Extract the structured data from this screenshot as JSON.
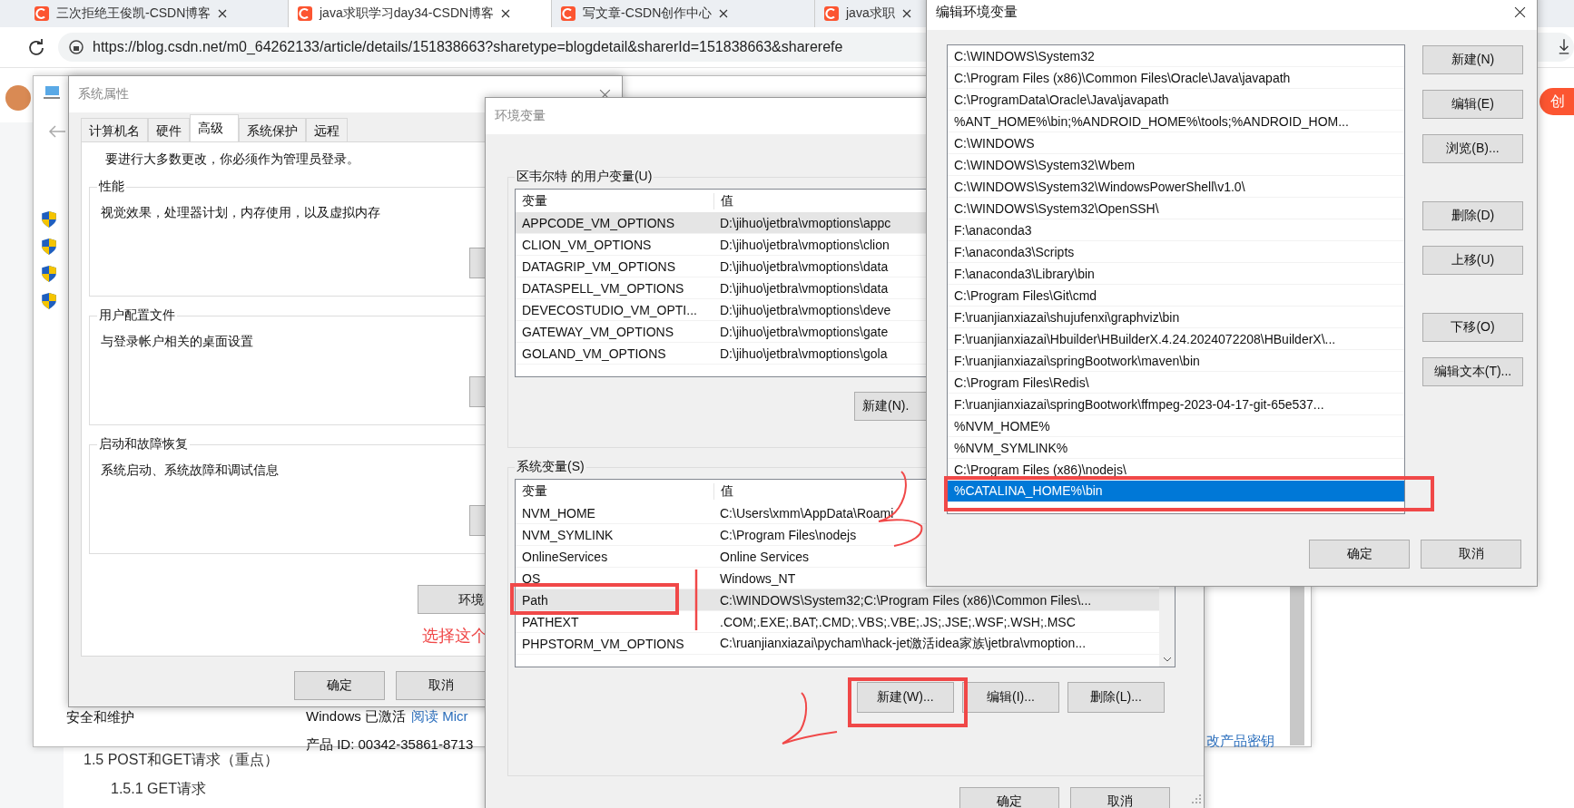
{
  "browser": {
    "tabs": [
      {
        "title": "三次拒绝王俊凯-CSDN博客",
        "selected": false
      },
      {
        "title": "java求职学习day34-CSDN博客",
        "selected": true
      },
      {
        "title": "写文章-CSDN创作中心",
        "selected": false
      },
      {
        "title": "java求职",
        "selected": false
      }
    ],
    "url": "https://blog.csdn.net/m0_64262133/article/details/151838663?sharetype=blogdetail&sharerId=151838663&sharerefe",
    "create_button": "创"
  },
  "page": {
    "headings": [
      "1.5 POST和GET请求（重点）",
      "1.5.1 GET请求"
    ]
  },
  "control_panel": {
    "item": "安全和维护",
    "activation": "Windows 已激活",
    "activation_link": "阅读 Micr",
    "product_id": "产品 ID: 00342-35861-8713",
    "change_key_link": "改产品密钥"
  },
  "system_properties": {
    "title": "系统属性",
    "tabs": [
      {
        "label": "计算机名",
        "selected": false
      },
      {
        "label": "硬件",
        "selected": false
      },
      {
        "label": "高级",
        "selected": true
      },
      {
        "label": "系统保护",
        "selected": false
      },
      {
        "label": "远程",
        "selected": false
      }
    ],
    "notice": "要进行大多数更改，你必须作为管理员登录。",
    "groups": [
      {
        "title": "性能",
        "description": "视觉效果，处理器计划，内存使用，以及虚拟内存"
      },
      {
        "title": "用户配置文件",
        "description": "与登录帐户相关的桌面设置"
      },
      {
        "title": "启动和故障恢复",
        "description": "系统启动、系统故障和调试信息"
      }
    ],
    "env_button": "环境",
    "buttons": [
      "确定",
      "取消"
    ]
  },
  "environment_variables": {
    "title": "环境变量",
    "user": {
      "title": "区韦尔特 的用户变量(U)",
      "columns": [
        "变量",
        "值"
      ],
      "rows": [
        {
          "name": "APPCODE_VM_OPTIONS",
          "value": "D:\\jihuo\\jetbra\\vmoptions\\appc",
          "selected": true
        },
        {
          "name": "CLION_VM_OPTIONS",
          "value": "D:\\jihuo\\jetbra\\vmoptions\\clion",
          "selected": false
        },
        {
          "name": "DATAGRIP_VM_OPTIONS",
          "value": "D:\\jihuo\\jetbra\\vmoptions\\data",
          "selected": false
        },
        {
          "name": "DATASPELL_VM_OPTIONS",
          "value": "D:\\jihuo\\jetbra\\vmoptions\\data",
          "selected": false
        },
        {
          "name": "DEVECOSTUDIO_VM_OPTI...",
          "value": "D:\\jihuo\\jetbra\\vmoptions\\deve",
          "selected": false
        },
        {
          "name": "GATEWAY_VM_OPTIONS",
          "value": "D:\\jihuo\\jetbra\\vmoptions\\gate",
          "selected": false
        },
        {
          "name": "GOLAND_VM_OPTIONS",
          "value": "D:\\jihuo\\jetbra\\vmoptions\\gola",
          "selected": false
        }
      ],
      "buttons": [
        "新建(N)."
      ]
    },
    "system": {
      "title": "系统变量(S)",
      "columns": [
        "变量",
        "值"
      ],
      "rows": [
        {
          "name": "NVM_HOME",
          "value": "C:\\Users\\xmm\\AppData\\Roami",
          "selected": false
        },
        {
          "name": "NVM_SYMLINK",
          "value": "C:\\Program Files\\nodejs",
          "selected": false
        },
        {
          "name": "OnlineServices",
          "value": "Online Services",
          "selected": false
        },
        {
          "name": "OS",
          "value": "Windows_NT",
          "selected": false
        },
        {
          "name": "Path",
          "value": "C:\\WINDOWS\\System32;C:\\Program Files (x86)\\Common Files\\...",
          "selected": true
        },
        {
          "name": "PATHEXT",
          "value": ".COM;.EXE;.BAT;.CMD;.VBS;.VBE;.JS;.JSE;.WSF;.WSH;.MSC",
          "selected": false
        },
        {
          "name": "PHPSTORM_VM_OPTIONS",
          "value": "C:\\ruanjianxiazai\\pycham\\hack-jet激活idea家族\\jetbra\\vmoption...",
          "selected": false
        }
      ],
      "buttons": [
        "新建(W)...",
        "编辑(I)...",
        "删除(L)..."
      ]
    },
    "buttons": [
      "确定",
      "取消"
    ]
  },
  "edit_dialog": {
    "title": "编辑环境变量",
    "entries": [
      {
        "text": "C:\\WINDOWS\\System32",
        "selected": false
      },
      {
        "text": "C:\\Program Files (x86)\\Common Files\\Oracle\\Java\\javapath",
        "selected": false
      },
      {
        "text": "C:\\ProgramData\\Oracle\\Java\\javapath",
        "selected": false
      },
      {
        "text": "%ANT_HOME%\\bin;%ANDROID_HOME%\\tools;%ANDROID_HOM...",
        "selected": false
      },
      {
        "text": "C:\\WINDOWS",
        "selected": false
      },
      {
        "text": "C:\\WINDOWS\\System32\\Wbem",
        "selected": false
      },
      {
        "text": "C:\\WINDOWS\\System32\\WindowsPowerShell\\v1.0\\",
        "selected": false
      },
      {
        "text": "C:\\WINDOWS\\System32\\OpenSSH\\",
        "selected": false
      },
      {
        "text": "F:\\anaconda3",
        "selected": false
      },
      {
        "text": "F:\\anaconda3\\Scripts",
        "selected": false
      },
      {
        "text": "F:\\anaconda3\\Library\\bin",
        "selected": false
      },
      {
        "text": "C:\\Program Files\\Git\\cmd",
        "selected": false
      },
      {
        "text": "F:\\ruanjianxiazai\\shujufenxi\\graphviz\\bin",
        "selected": false
      },
      {
        "text": "F:\\ruanjianxiazai\\Hbuilder\\HBuilderX.4.24.2024072208\\HBuilderX\\...",
        "selected": false
      },
      {
        "text": "F:\\ruanjianxiazai\\springBootwork\\maven\\bin",
        "selected": false
      },
      {
        "text": "C:\\Program Files\\Redis\\",
        "selected": false
      },
      {
        "text": "F:\\ruanjianxiazai\\springBootwork\\ffmpeg-2023-04-17-git-65e537...",
        "selected": false
      },
      {
        "text": "%NVM_HOME%",
        "selected": false
      },
      {
        "text": "%NVM_SYMLINK%",
        "selected": false
      },
      {
        "text": "C:\\Program Files (x86)\\nodejs\\",
        "selected": false
      },
      {
        "text": "%CATALINA_HOME%\\bin",
        "selected": true
      }
    ],
    "side_buttons": [
      "新建(N)",
      "编辑(E)",
      "浏览(B)...",
      "删除(D)",
      "上移(U)",
      "下移(O)",
      "编辑文本(T)..."
    ],
    "buttons": [
      "确定",
      "取消"
    ]
  },
  "annotations": {
    "note": "选择这个"
  }
}
